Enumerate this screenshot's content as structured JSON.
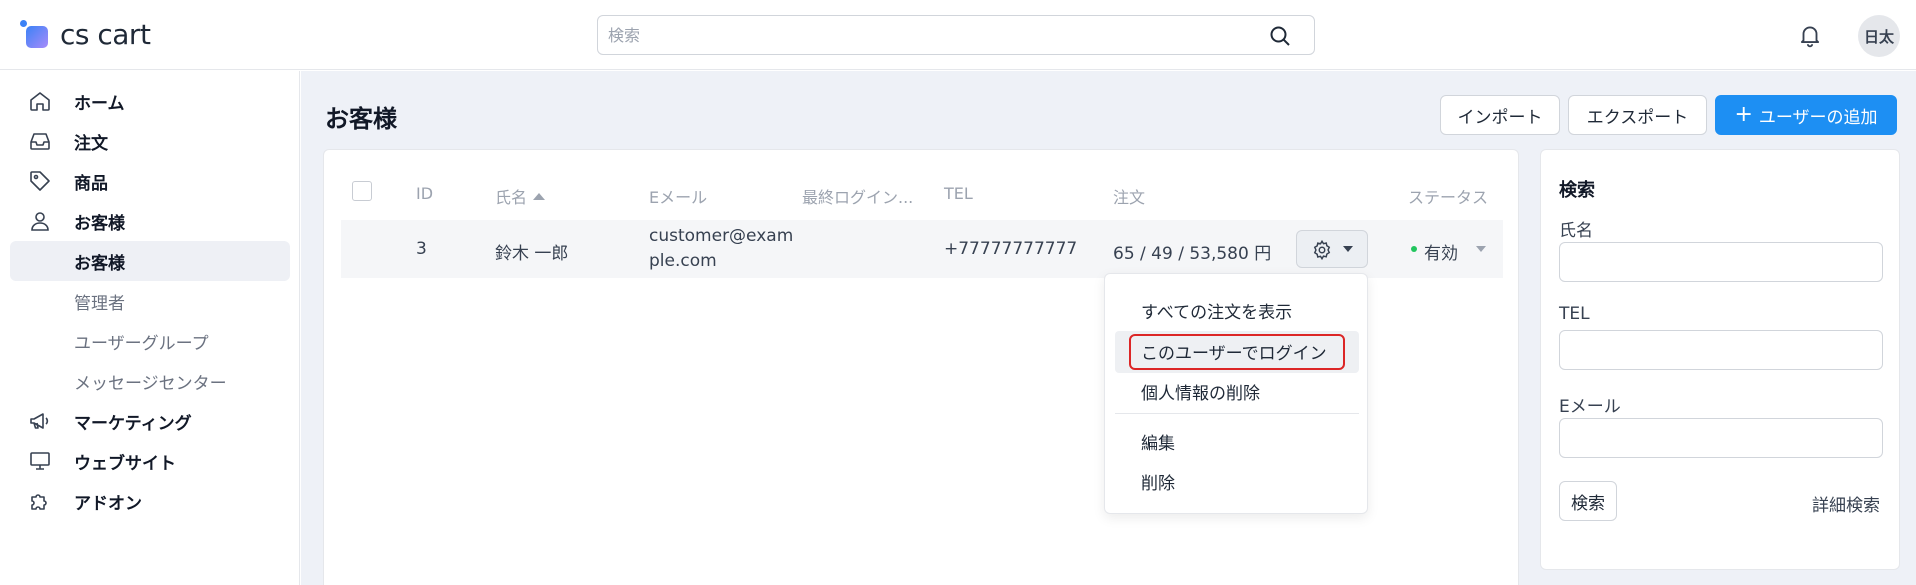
{
  "app": {
    "logo_text": "cs cart",
    "user_initials": "日太"
  },
  "top_search": {
    "placeholder": "検索"
  },
  "sidebar": {
    "items": [
      {
        "label": "ホーム",
        "icon": "home-icon"
      },
      {
        "label": "注文",
        "icon": "inbox-icon"
      },
      {
        "label": "商品",
        "icon": "tag-icon"
      },
      {
        "label": "お客様",
        "icon": "user-icon"
      },
      {
        "label": "お客様",
        "sub": true,
        "active": true
      },
      {
        "label": "管理者",
        "sub": true
      },
      {
        "label": "ユーザーグループ",
        "sub": true
      },
      {
        "label": "メッセージセンター",
        "sub": true
      },
      {
        "label": "マーケティング",
        "icon": "megaphone-icon"
      },
      {
        "label": "ウェブサイト",
        "icon": "monitor-icon"
      },
      {
        "label": "アドオン",
        "icon": "puzzle-icon"
      }
    ]
  },
  "page": {
    "title": "お客様",
    "import_label": "インポート",
    "export_label": "エクスポート",
    "add_user_label": "ユーザーの追加"
  },
  "table": {
    "headers": {
      "id": "ID",
      "name": "氏名",
      "email": "Eメール",
      "last_login": "最終ログイン...",
      "tel": "TEL",
      "orders": "注文",
      "status": "ステータス"
    },
    "rows": [
      {
        "id": "3",
        "name": "鈴木 一郎",
        "email_line1": "customer@exam",
        "email_line2": "ple.com",
        "tel": "+77777777777",
        "orders": "65 / 49 / 53,580 円",
        "status": "有効"
      }
    ]
  },
  "dropdown": {
    "items": [
      "すべての注文を表示",
      "このユーザーでログイン",
      "個人情報の削除",
      "編集",
      "削除"
    ],
    "highlighted_index": 1
  },
  "filter": {
    "title": "検索",
    "name_label": "氏名",
    "tel_label": "TEL",
    "email_label": "Eメール",
    "search_button": "検索",
    "advanced_link": "詳細検索"
  },
  "colors": {
    "primary": "#1d8ff3",
    "status_active": "#22c55e",
    "highlight_border": "#dc2626"
  }
}
